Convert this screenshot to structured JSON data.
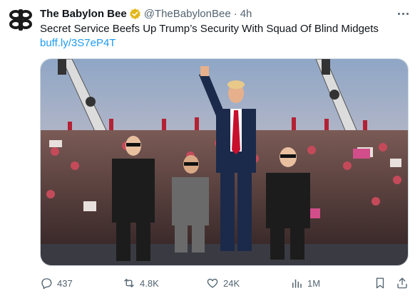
{
  "account": {
    "display_name": "The Babylon Bee",
    "handle": "@TheBabylonBee",
    "separator": "·",
    "time_ago": "4h"
  },
  "tweet": {
    "text": "Secret Service Beefs Up Trump’s Security With Squad Of Blind Midgets",
    "link": "buff.ly/3S7eP4T"
  },
  "actions": {
    "replies": "437",
    "reposts": "4.8K",
    "likes": "24K",
    "views": "1M"
  },
  "icons": {
    "avatar": "babylon-bee-logo",
    "verified": "gold-verified-badge",
    "more": "ellipsis-icon",
    "reply": "reply-icon",
    "repost": "repost-icon",
    "like": "heart-icon",
    "views": "views-icon",
    "bookmark": "bookmark-icon",
    "share": "share-icon"
  },
  "colors": {
    "text": "#0f1419",
    "secondary": "#536471",
    "link": "#1d9bf0",
    "verified_gold": "#e2b719",
    "logo": "#1a1a1a"
  }
}
